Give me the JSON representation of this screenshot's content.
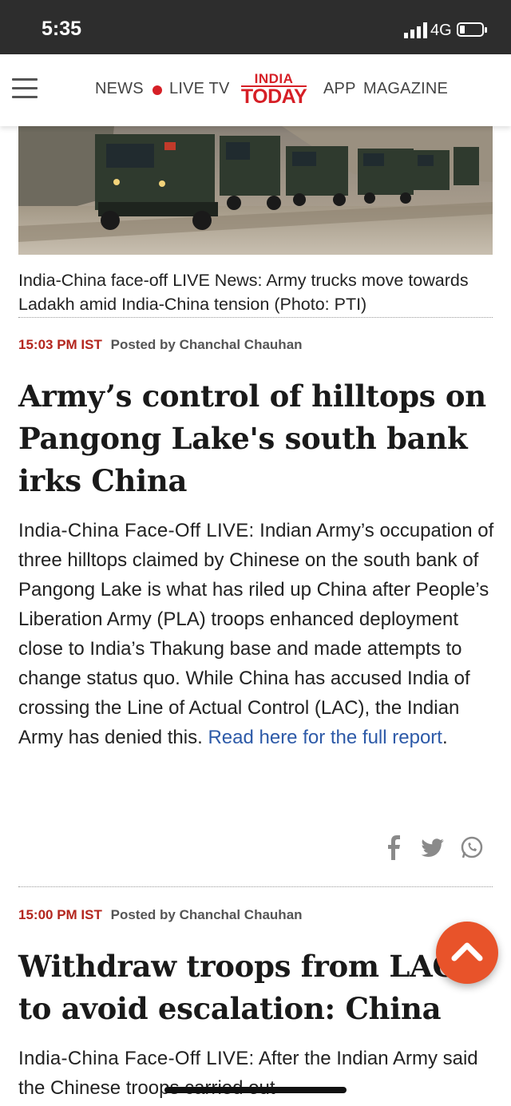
{
  "status": {
    "time": "5:35",
    "network": "4G"
  },
  "header": {
    "nav": {
      "news": "NEWS",
      "live_tv": "LIVE TV",
      "app": "APP",
      "magazine": "MAGAZINE"
    },
    "logo": {
      "line1": "INDIA",
      "line2": "TODAY"
    },
    "colors": {
      "brand": "#d61f26"
    }
  },
  "hero": {
    "caption": "India-China face-off LIVE News: Army trucks move towards Ladakh amid India-China tension (Photo: PTI)"
  },
  "posts": [
    {
      "time": "15:03 PM IST",
      "author": "Posted by Chanchal Chauhan",
      "headline": "Army’s control of hilltops on Pangong Lake's south bank irks China",
      "lead": "India-China Face-Off LIVE:",
      "body": " Indian Army’s occupation of three hilltops claimed by Chinese on the south bank of Pangong Lake is what has riled up China after People’s Liberation Army (PLA) troops enhanced deployment close to India’s Thakung base and made attempts to change status quo. While China has accused India of crossing the Line of Actual Control (LAC), the Indian Army has denied this. ",
      "link": "Read here for the full report",
      "after_link": "."
    },
    {
      "time": "15:00 PM IST",
      "author": "Posted by Chanchal Chauhan",
      "headline": "Withdraw troops from LAC to avoid escalation: China",
      "lead": "India-China Face-Off LIVE:",
      "body": " After the Indian Army said the Chinese troops carried out"
    }
  ],
  "icons": {
    "share": [
      "facebook-icon",
      "twitter-icon",
      "whatsapp-icon"
    ],
    "scroll_top": "chevron-up-icon"
  }
}
